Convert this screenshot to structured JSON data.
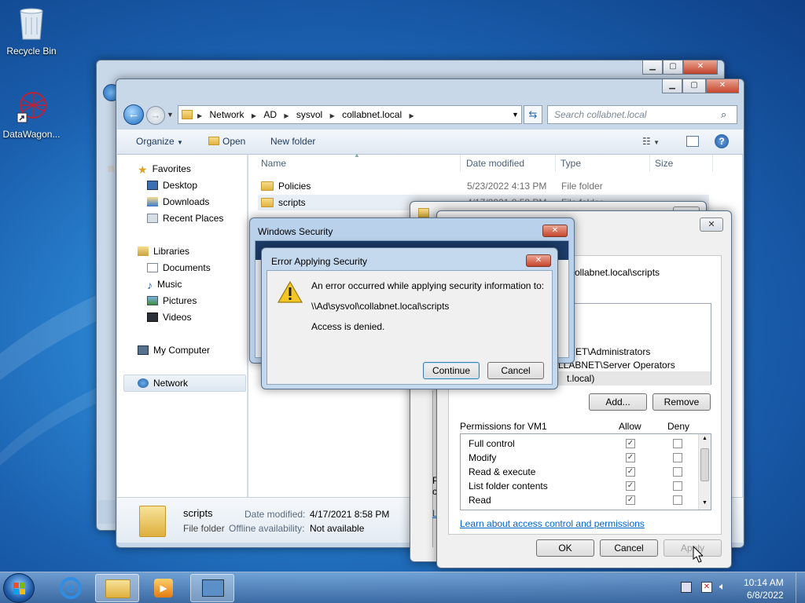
{
  "desktop": {
    "icons": [
      {
        "label": "Recycle Bin"
      },
      {
        "label": "DataWagon..."
      }
    ]
  },
  "explorer": {
    "address": {
      "crumbs": [
        "Network",
        "AD",
        "sysvol",
        "collabnet.local"
      ],
      "search_placeholder": "Search collabnet.local"
    },
    "toolbar": {
      "organize": "Organize",
      "open": "Open",
      "new_folder": "New folder"
    },
    "nav": {
      "favorites": "Favorites",
      "desktop": "Desktop",
      "downloads": "Downloads",
      "recent": "Recent Places",
      "libraries": "Libraries",
      "documents": "Documents",
      "music": "Music",
      "pictures": "Pictures",
      "videos": "Videos",
      "computer": "My Computer",
      "network": "Network"
    },
    "columns": {
      "name": "Name",
      "date": "Date modified",
      "type": "Type",
      "size": "Size"
    },
    "files": [
      {
        "name": "Policies",
        "date": "5/23/2022 4:13 PM",
        "type": "File folder"
      },
      {
        "name": "scripts",
        "date": "4/17/2021 8:58 PM",
        "type": "File folder"
      }
    ],
    "details": {
      "name": "scripts",
      "date_label": "Date modified:",
      "date_value": "4/17/2021 8:58 PM",
      "type": "File folder",
      "offline_label": "Offline availability:",
      "offline_value": "Not available"
    }
  },
  "permissions": {
    "path_fragment": "ollabnet.local\\scripts",
    "groups": [
      "ET\\Administrators",
      "LLABNET\\Server Operators",
      "t.local)"
    ],
    "add_label": "Add...",
    "remove_label": "Remove",
    "perm_header": "Permissions for VM1",
    "allow_header": "Allow",
    "deny_header": "Deny",
    "perms": [
      {
        "name": "Full control",
        "allow": "✓",
        "deny": ""
      },
      {
        "name": "Modify",
        "allow": "✓",
        "deny": ""
      },
      {
        "name": "Read & execute",
        "allow": "✓",
        "deny": ""
      },
      {
        "name": "List folder contents",
        "allow": "✓",
        "deny": ""
      },
      {
        "name": "Read",
        "allow": "✓",
        "deny": ""
      }
    ],
    "learn_link": "Learn about access control and permissions",
    "ok_label": "OK",
    "cancel_label": "Cancel",
    "apply_label": "Apply",
    "left_fragments": [
      "P",
      "c",
      "L"
    ]
  },
  "security_window": {
    "title": "Windows Security"
  },
  "error_dialog": {
    "title": "Error Applying Security",
    "line1": "An error occurred while applying security information to:",
    "path": "\\\\Ad\\sysvol\\collabnet.local\\scripts",
    "line3": "Access is denied.",
    "continue_label": "Continue",
    "cancel_label": "Cancel"
  },
  "taskbar": {
    "time": "10:14 AM",
    "date": "6/8/2022"
  }
}
